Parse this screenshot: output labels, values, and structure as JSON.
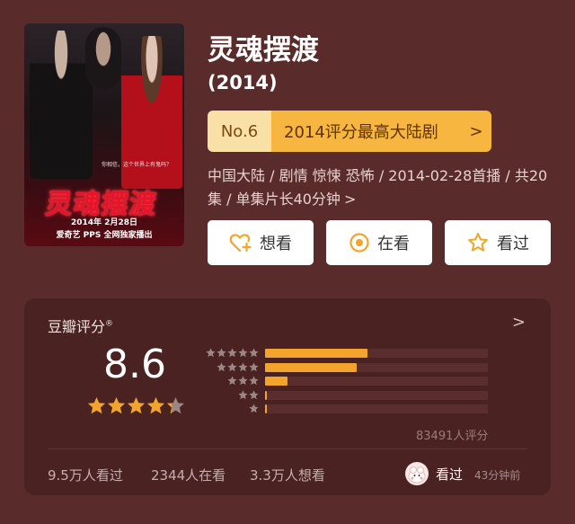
{
  "poster": {
    "tagline": "你相信，这个世界上有鬼吗？",
    "logo_title": "灵魂摆渡",
    "date_line": "2014年 2月28日",
    "platform_line": "爱奇艺 PPS 全网独家播出"
  },
  "title": "灵魂摆渡",
  "year": "(2014)",
  "rank": {
    "number": "No.6",
    "text": "2014评分最高大陆剧",
    "arrow": ">"
  },
  "meta": {
    "text": "中国大陆 / 剧情 惊悚 恐怖 / 2014-02-28首播 / 共20集 / 单集片长40分钟",
    "chevron": ">"
  },
  "actions": [
    {
      "label": "想看",
      "icon": "heart-plus-icon"
    },
    {
      "label": "在看",
      "icon": "target-circle-icon"
    },
    {
      "label": "看过",
      "icon": "star-outline-icon"
    }
  ],
  "rating": {
    "label": "豆瓣评分",
    "mark": "®",
    "chevron": ">",
    "score": "8.6",
    "stars_value": 4.3,
    "distribution": [
      {
        "stars": 5,
        "fraction": 0.46
      },
      {
        "stars": 4,
        "fraction": 0.41
      },
      {
        "stars": 3,
        "fraction": 0.1
      },
      {
        "stars": 2,
        "fraction": 0.01
      },
      {
        "stars": 1,
        "fraction": 0.01
      }
    ],
    "count": "83491人评分",
    "colors": {
      "accent": "#f2a42b",
      "track": "#5b2e2e",
      "star_gray": "#9a8684"
    }
  },
  "stats": {
    "watched": "9.5万人看过",
    "watching": "2344人在看",
    "want": "3.3万人想看"
  },
  "me": {
    "status": "看过",
    "time": "43分钟前"
  }
}
